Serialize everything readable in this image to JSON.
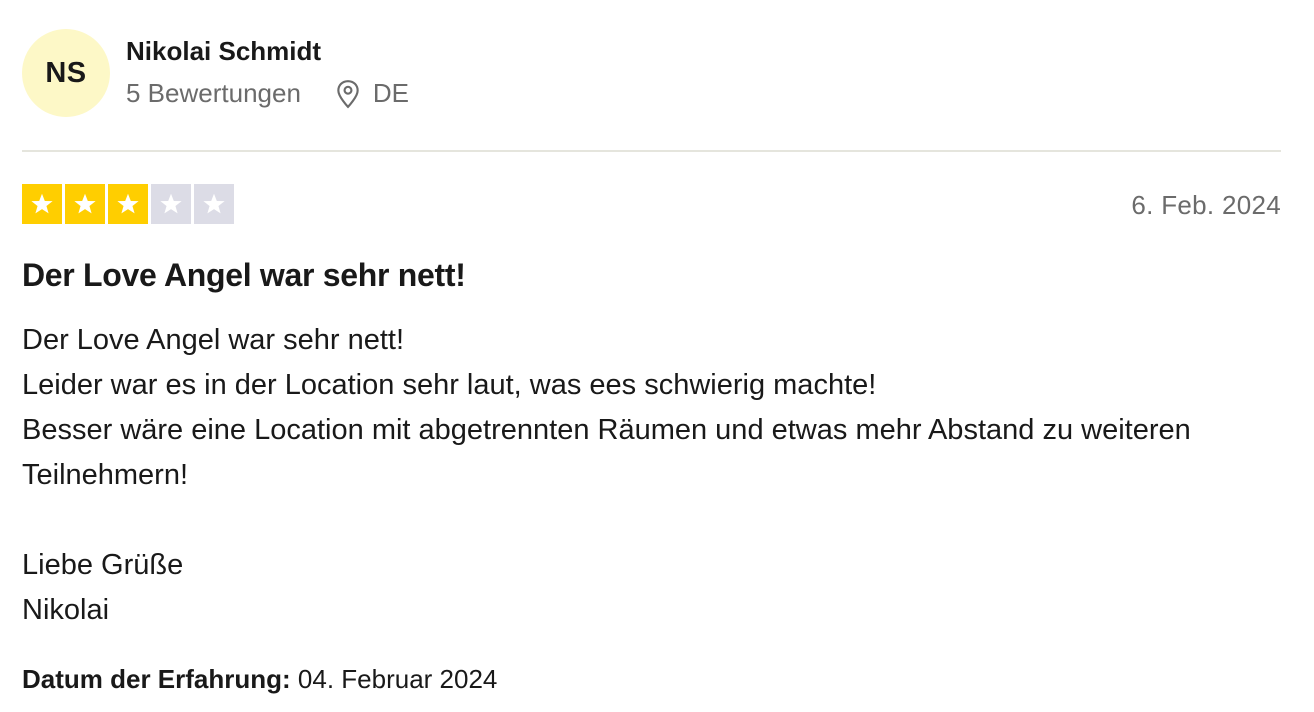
{
  "author": {
    "initials": "NS",
    "name": "Nikolai Schmidt",
    "reviews_count": "5 Bewertungen",
    "country": "DE",
    "avatar_color": "#fdf8c7"
  },
  "review": {
    "rating": 3,
    "max_rating": 5,
    "star_filled_color": "#ffce00",
    "star_empty_color": "#dcdce6",
    "date": "6. Feb. 2024",
    "title": "Der Love Angel war sehr nett!",
    "body_lines": [
      "Der Love Angel war sehr nett!",
      "Leider war es in der Location sehr laut, was ees schwierig machte!",
      "Besser wäre eine Location mit abgetrennten Räumen und etwas mehr Abstand zu weiteren Teilnehmern!",
      "",
      "Liebe Grüße",
      "Nikolai"
    ],
    "experience_label": "Datum der Erfahrung:",
    "experience_date": "04. Februar 2024"
  },
  "icons": {
    "location": "location-pin-icon",
    "star": "star-icon"
  }
}
